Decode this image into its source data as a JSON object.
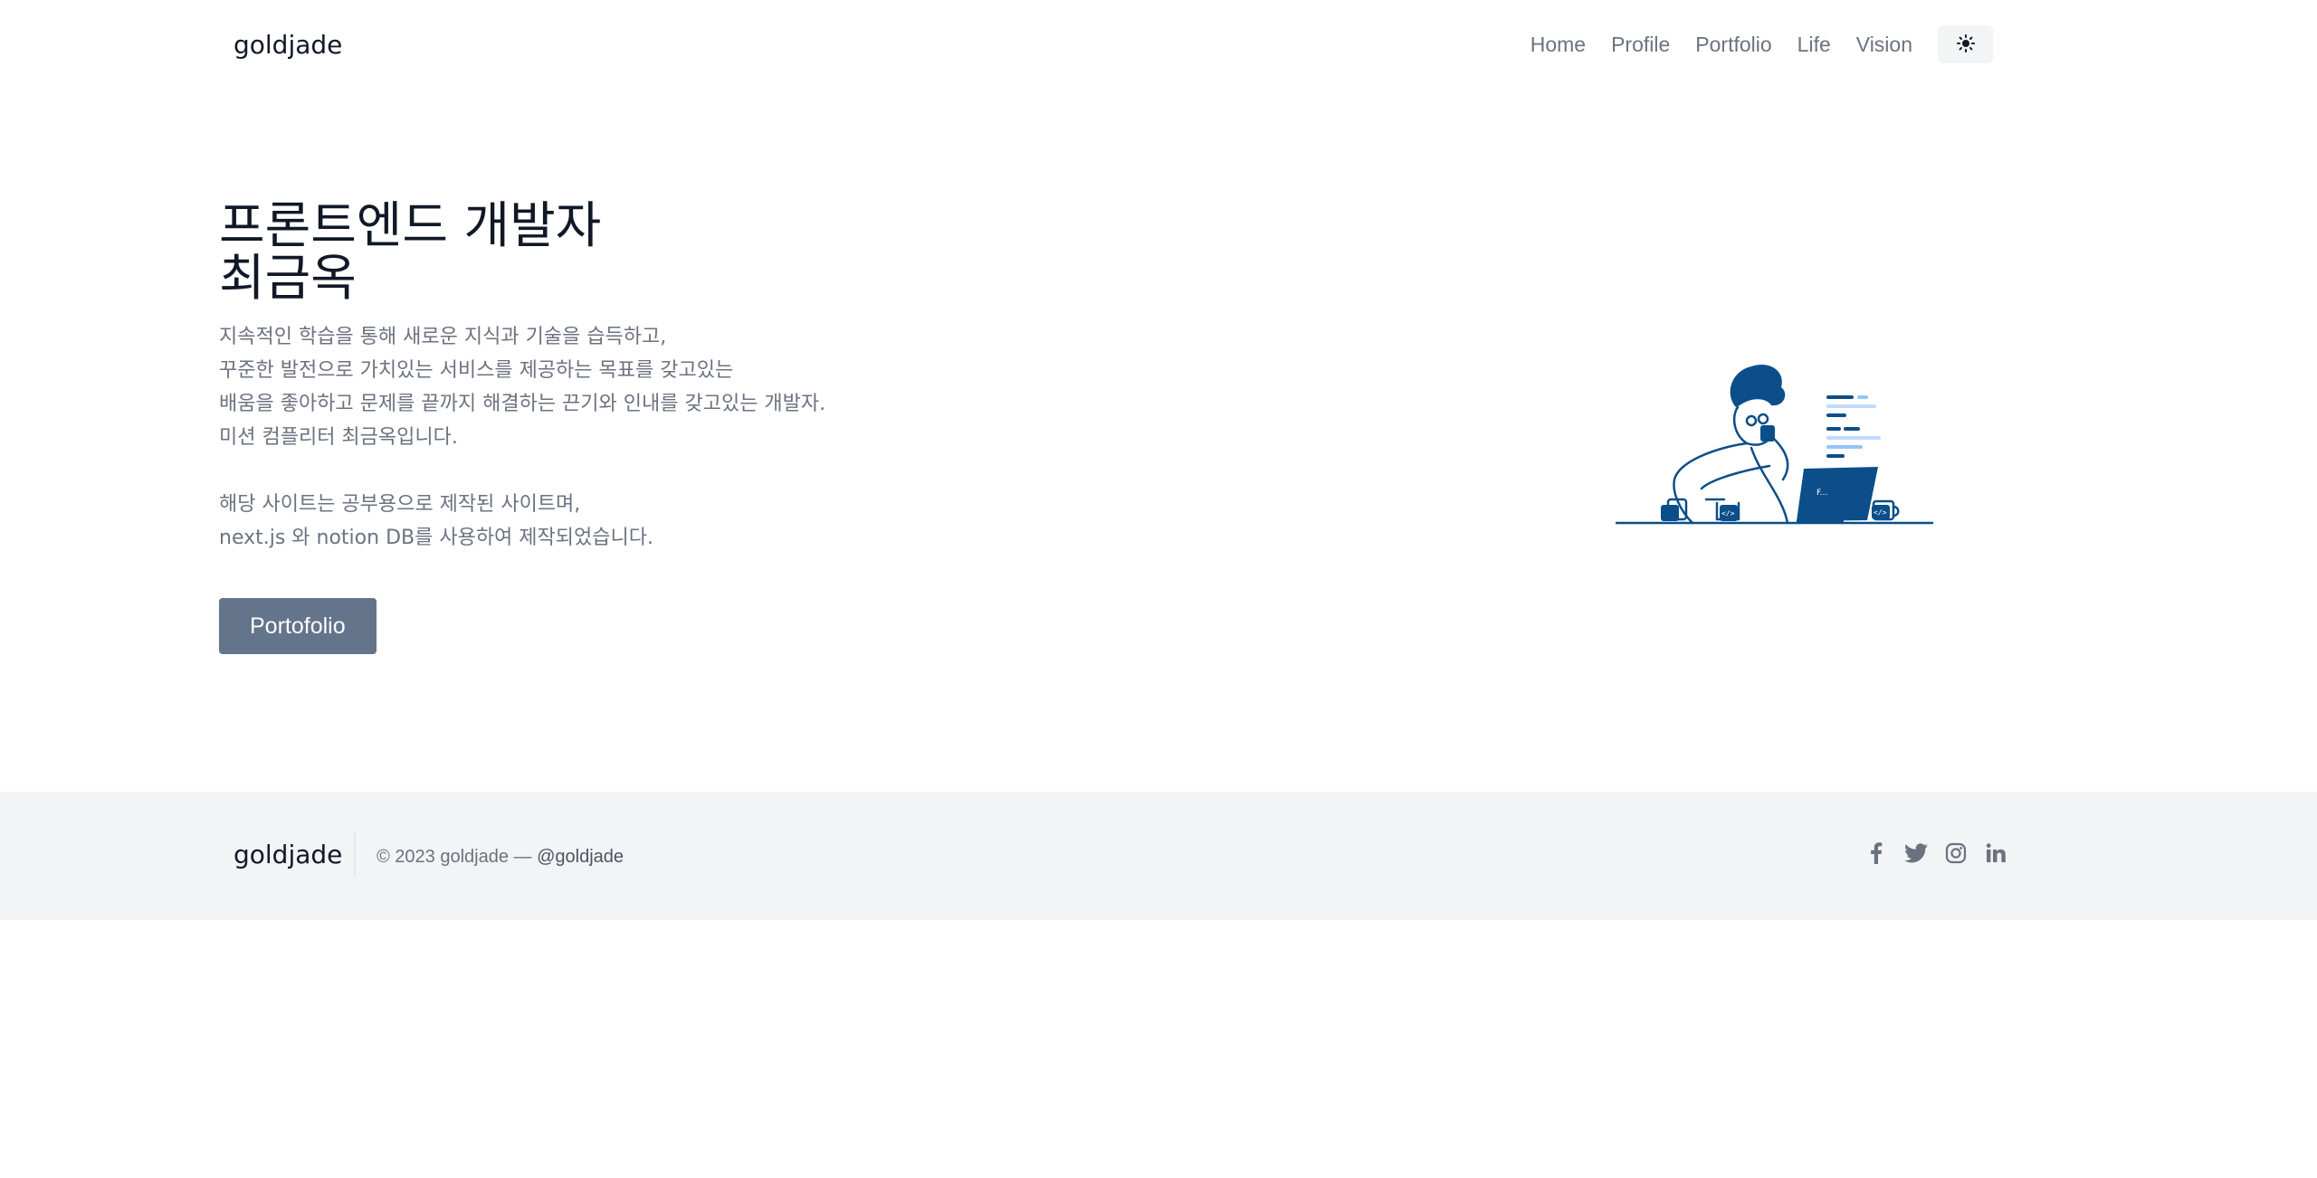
{
  "header": {
    "brand": "goldjade",
    "nav": [
      "Home",
      "Profile",
      "Portfolio",
      "Life",
      "Vision"
    ],
    "theme_toggle_icon": "sun-icon"
  },
  "hero": {
    "title_lines": [
      "프론트엔드 개발자",
      "최금옥"
    ],
    "description_lines": [
      "지속적인 학습을 통해 새로운 지식과 기술을 습득하고,",
      "꾸준한 발전으로 가치있는 서비스를 제공하는 목표를 갖고있는",
      "배움을 좋아하고 문제를 끝까지 해결하는 끈기와 인내를 갖고있는 개발자.",
      "미션 컴플리터 최금옥입니다."
    ],
    "note_lines": [
      "해당 사이트는 공부용으로 제작된 사이트며,",
      "next.js 와 notion DB를 사용하여 제작되었습니다."
    ],
    "cta_label": "Portofolio"
  },
  "footer": {
    "brand": "goldjade",
    "copyright": "© 2023 goldjade —",
    "handle": "@goldjade",
    "socials": [
      "facebook-icon",
      "twitter-icon",
      "instagram-icon",
      "linkedin-icon"
    ]
  },
  "colors": {
    "accent_button": "#64748b",
    "illustration_blue": "#0b4e8a",
    "footer_bg": "#f3f4f6"
  }
}
